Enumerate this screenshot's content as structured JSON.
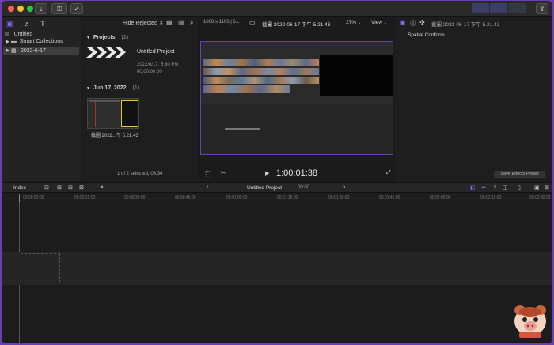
{
  "toolbar": {
    "import_icon": "download-arrow",
    "key_icon": "keyword",
    "check_icon": "check-circle",
    "share_icon": "share"
  },
  "library": {
    "library_name": "Untitled",
    "items": [
      {
        "label": "Smart Collections"
      },
      {
        "label": "2022-6-17"
      }
    ]
  },
  "browser": {
    "filter_label": "Hide Rejected",
    "projects_heading": "Projects",
    "projects_count": "(1)",
    "project_name": "Untitled Project",
    "project_date": "2022/6/17, 5:30 PM",
    "project_duration": "00:00:00:00",
    "date_heading": "Jun 17, 2022",
    "date_count": "(1)",
    "clip_name": "截圖 2022...午 5.21.43",
    "selection_status": "1 of 2 selected, 03:34"
  },
  "viewer": {
    "resolution": "1808 x 1106 | 6...",
    "clip_title": "截圖 2022-06-17 下午 5.21.43",
    "zoom": "27%",
    "view_label": "View",
    "timecode": "1:00:01:38"
  },
  "inspector": {
    "clip_title": "截圖 2022-06-17 下午 5.21.43",
    "section": "Spatial Conform",
    "save_button": "Save Effects Preset"
  },
  "timeline": {
    "index_label": "Index",
    "project_name": "Untitled Project",
    "duration": "00:00",
    "ruler": [
      "00:00:00:00",
      "00:00:15:00",
      "00:00:30:00",
      "00:00:45:00",
      "00:01:00:00",
      "00:01:15:00",
      "00:01:30:00",
      "00:01:45:00",
      "00:02:00:00",
      "00:02:15:00",
      "00:02:30:00"
    ]
  },
  "colors": {
    "accent": "#7b6cf6",
    "selection_yellow": "#e8c43a",
    "window_border": "#6a3fb5"
  }
}
